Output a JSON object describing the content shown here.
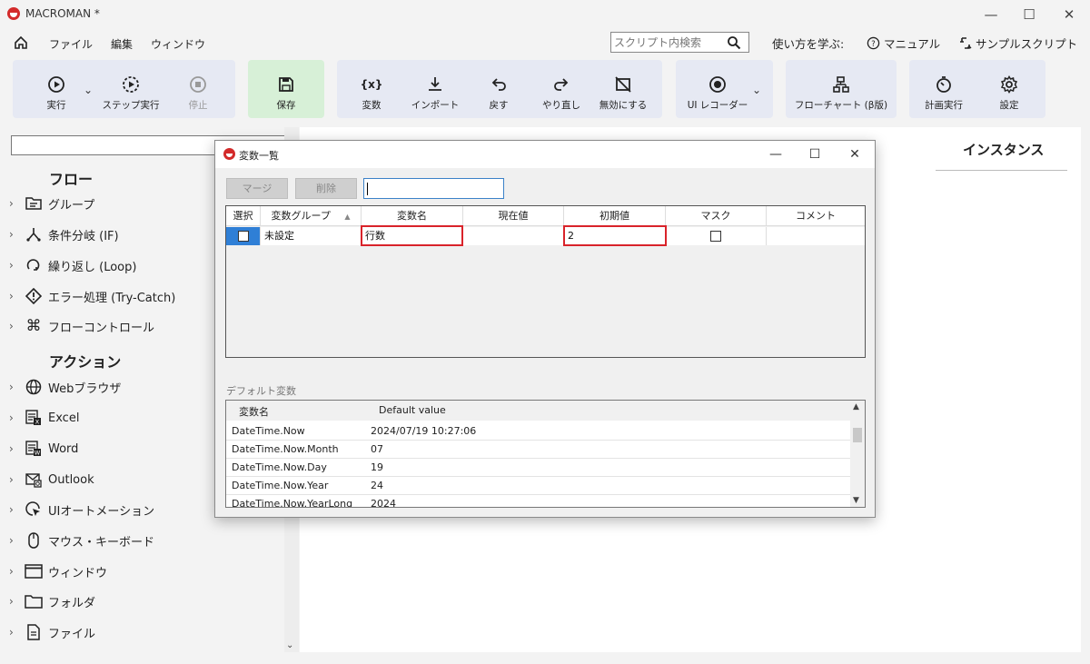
{
  "app": {
    "title": "MACROMAN *",
    "window_controls": {
      "minimize": "—",
      "maximize": "☐",
      "close": "✕"
    }
  },
  "menu": {
    "items": [
      "ファイル",
      "編集",
      "ウィンドウ"
    ],
    "search_placeholder": "スクリプト内検索",
    "help_learn": "使い方を学ぶ:",
    "manual": "マニュアル",
    "samples": "サンプルスクリプト"
  },
  "toolbar": {
    "run": "実行",
    "step_run": "ステップ実行",
    "stop": "停止",
    "save": "保存",
    "variables": "変数",
    "import": "インポート",
    "undo": "戻す",
    "redo": "やり直し",
    "disable": "無効にする",
    "ui_recorder": "UI レコーダー",
    "flowchart": "フローチャート (β版)",
    "schedule": "計画実行",
    "settings": "設定"
  },
  "left_panel": {
    "flow_header": "フロー",
    "flow_items": [
      "グループ",
      "条件分岐 (IF)",
      "繰り返し (Loop)",
      "エラー処理 (Try-Catch)",
      "フローコントロール"
    ],
    "action_header": "アクション",
    "action_items": [
      "Webブラウザ",
      "Excel",
      "Word",
      "Outlook",
      "UIオートメーション",
      "マウス・キーボード",
      "ウィンドウ",
      "フォルダ",
      "ファイル"
    ]
  },
  "main": {
    "instance_title": "インスタンス"
  },
  "dialog": {
    "title": "変数一覧",
    "merge_button": "マージ",
    "delete_button": "削除",
    "columns": [
      "選択",
      "変数グループ",
      "変数名",
      "現在値",
      "初期値",
      "マスク",
      "コメント"
    ],
    "rows": [
      {
        "group": "未設定",
        "name": "行数",
        "current": "",
        "initial": "2",
        "comment": ""
      }
    ],
    "default_section_label": "デフォルト変数",
    "default_columns": [
      "変数名",
      "Default value"
    ],
    "default_rows": [
      {
        "name": "DateTime.Now",
        "value": "2024/07/19 10:27:06"
      },
      {
        "name": "DateTime.Now.Month",
        "value": "07"
      },
      {
        "name": "DateTime.Now.Day",
        "value": "19"
      },
      {
        "name": "DateTime.Now.Year",
        "value": "24"
      },
      {
        "name": "DateTime.Now.YearLong",
        "value": "2024"
      }
    ]
  }
}
